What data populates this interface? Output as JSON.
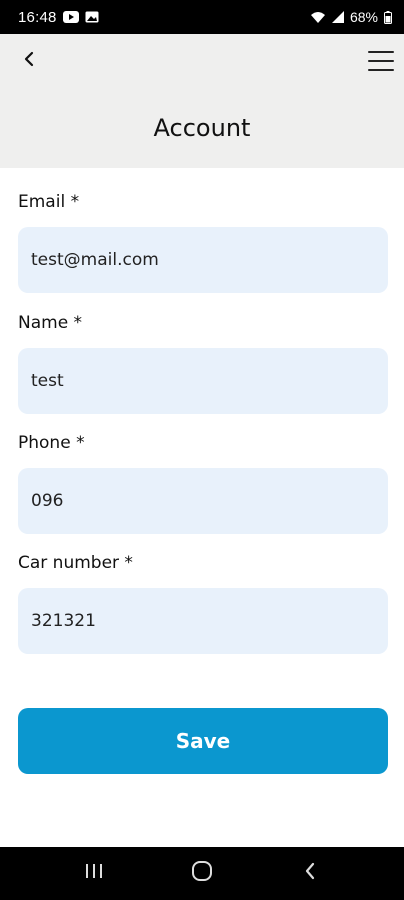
{
  "status_bar": {
    "time": "16:48",
    "battery": "68%",
    "icons": [
      "youtube-icon",
      "gallery-icon",
      "wifi-icon",
      "signal-icon",
      "battery-icon"
    ]
  },
  "header": {
    "title": "Account",
    "back_icon": "chevron-left-icon",
    "menu_icon": "hamburger-menu-icon"
  },
  "form": {
    "fields": [
      {
        "label": "Email *",
        "value": "test@mail.com"
      },
      {
        "label": "Name *",
        "value": "test"
      },
      {
        "label": "Phone *",
        "value": "096"
      },
      {
        "label": "Car number *",
        "value": "321321"
      }
    ],
    "save_label": "Save"
  },
  "nav_bar": {
    "icons": [
      "recent-apps-icon",
      "home-icon",
      "back-icon"
    ]
  },
  "colors": {
    "header_bg": "#efefee",
    "input_bg": "#e8f1fb",
    "accent": "#0b97cf"
  }
}
